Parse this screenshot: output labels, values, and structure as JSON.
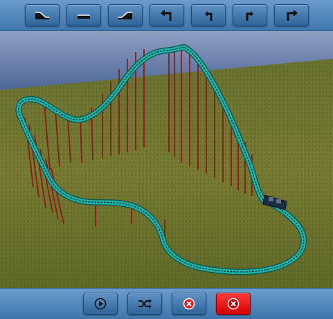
{
  "top_toolbar": {
    "buttons": [
      {
        "name": "slope-down-button",
        "icon": "slope-down-icon"
      },
      {
        "name": "flat-track-button",
        "icon": "flat-track-icon"
      },
      {
        "name": "slope-up-button",
        "icon": "slope-up-icon"
      },
      {
        "name": "sharp-left-turn-button",
        "icon": "sharp-left-turn-icon"
      },
      {
        "name": "left-turn-button",
        "icon": "left-turn-icon"
      },
      {
        "name": "right-turn-button",
        "icon": "right-turn-icon"
      },
      {
        "name": "sharp-right-turn-button",
        "icon": "sharp-right-turn-icon"
      }
    ]
  },
  "bottom_toolbar": {
    "buttons": [
      {
        "name": "play-button",
        "icon": "play-icon"
      },
      {
        "name": "shuffle-button",
        "icon": "shuffle-icon"
      },
      {
        "name": "delete-piece-button",
        "icon": "delete-icon"
      },
      {
        "name": "clear-track-button",
        "icon": "clear-icon",
        "color": "#ff0000"
      }
    ]
  },
  "scene": {
    "sky_color": "#6f86ad",
    "grass_color": "#6f7a2c",
    "track_color": "#1fa49a",
    "support_color": "#8b1a1a",
    "train_color": "#2a3a5a"
  }
}
